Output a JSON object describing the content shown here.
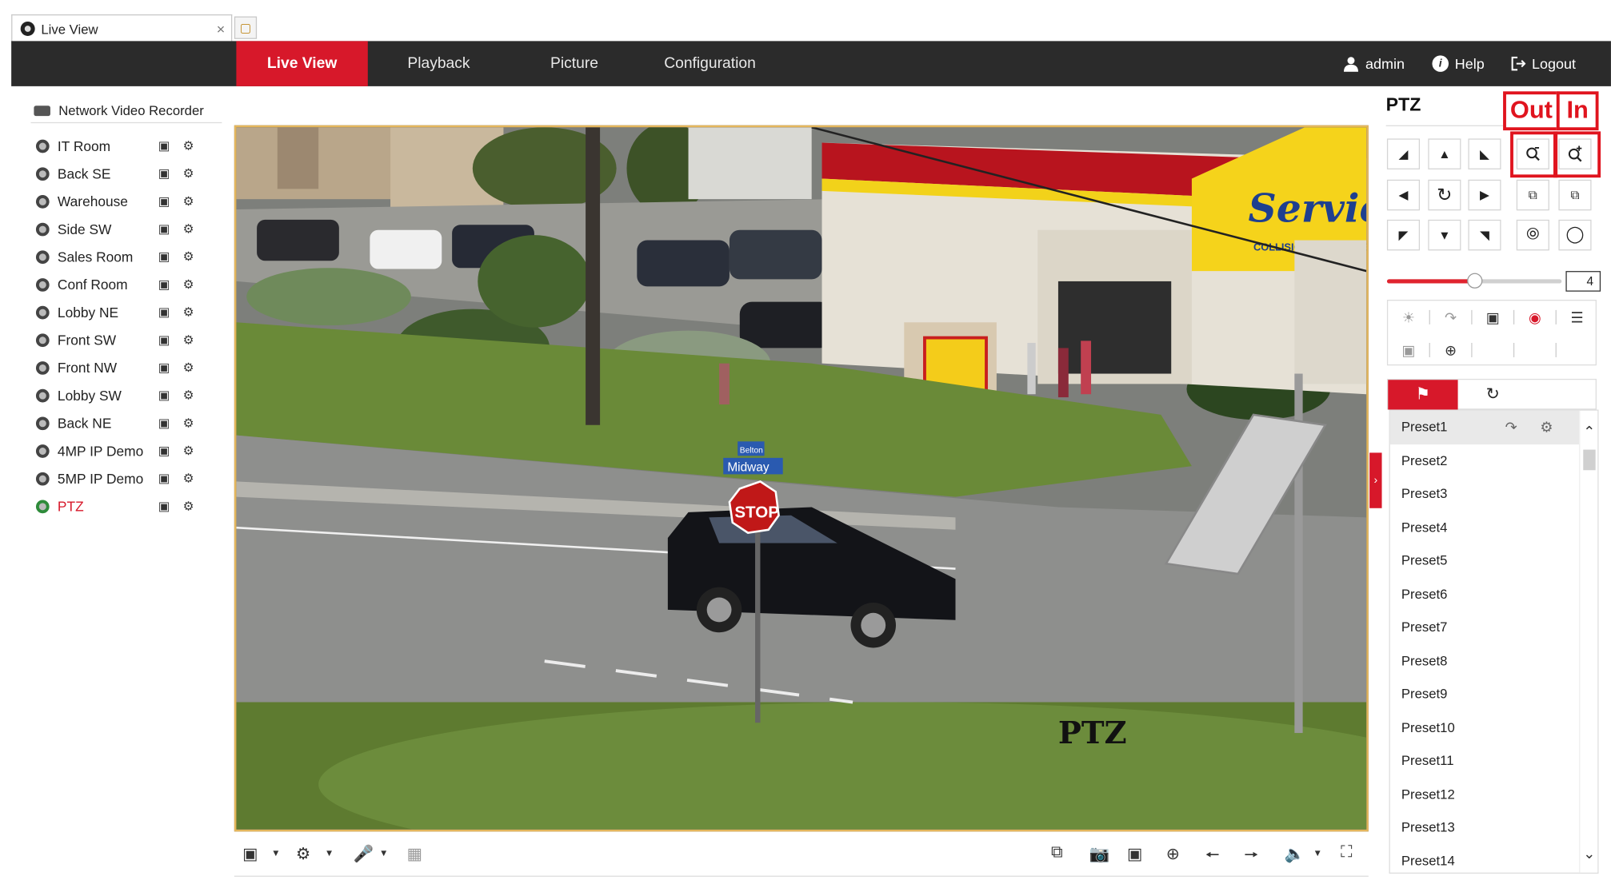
{
  "browser": {
    "tab_title": "Live View",
    "close_glyph": "×"
  },
  "nav": {
    "items": [
      "Live View",
      "Playback",
      "Picture",
      "Configuration"
    ],
    "active": "Live View",
    "user": "admin",
    "help": "Help",
    "logout": "Logout"
  },
  "sidebar": {
    "device": "Network Video Recorder",
    "cameras": [
      "IT Room",
      "Back SE",
      "Warehouse",
      "Side SW",
      "Sales Room",
      "Conf Room",
      "Lobby NE",
      "Front SW",
      "Front NW",
      "Lobby SW",
      "Back NE",
      "4MP IP Demo",
      "5MP IP Demo",
      "PTZ"
    ],
    "active_camera": "PTZ"
  },
  "video": {
    "overlay_text": "PTZ",
    "signs": {
      "stop": "STOP",
      "street": "Midway",
      "street_top": "Belton",
      "brand": "ServiceKing",
      "brand_sub": "COLLISION REPAIR CE"
    }
  },
  "ptz": {
    "title": "PTZ",
    "annotations": {
      "out": "Out",
      "in": "In"
    },
    "speed": "4",
    "speed_fraction": 0.5,
    "presets": [
      "Preset1",
      "Preset2",
      "Preset3",
      "Preset4",
      "Preset5",
      "Preset6",
      "Preset7",
      "Preset8",
      "Preset9",
      "Preset10",
      "Preset11",
      "Preset12",
      "Preset13",
      "Preset14"
    ],
    "selected_preset": "Preset1"
  },
  "colors": {
    "accent": "#d7182a",
    "nav_bg": "#2b2b2b",
    "annotation": "#e0141e",
    "video_border": "#e4b65c"
  }
}
